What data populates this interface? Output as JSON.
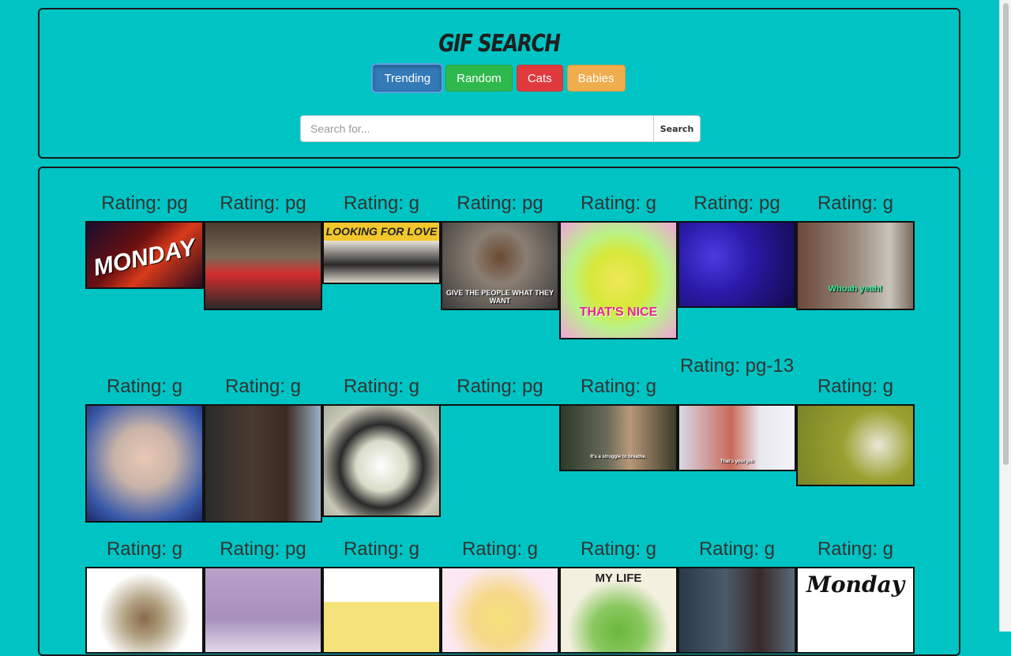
{
  "header": {
    "title": "GIF SEARCH",
    "buttons": [
      {
        "label": "Trending",
        "color": "#337ab7"
      },
      {
        "label": "Random",
        "color": "#2fb84c"
      },
      {
        "label": "Cats",
        "color": "#e0393e"
      },
      {
        "label": "Babies",
        "color": "#f0ad4e"
      }
    ],
    "search": {
      "placeholder": "Search for...",
      "button_label": "Search"
    }
  },
  "results": {
    "rows": [
      [
        {
          "rating": "Rating: pg",
          "caption": "MONDAY"
        },
        {
          "rating": "Rating: pg",
          "caption": ""
        },
        {
          "rating": "Rating: g",
          "caption": "LOOKING FOR LOVE"
        },
        {
          "rating": "Rating: pg",
          "caption": "GIVE THE PEOPLE WHAT THEY WANT"
        },
        {
          "rating": "Rating: g",
          "caption": "THAT'S NICE"
        },
        {
          "rating": "Rating: pg",
          "caption": ""
        },
        {
          "rating": "Rating: g",
          "caption": "Whoah yeah!"
        }
      ],
      [
        {
          "rating": "Rating: g",
          "caption": ""
        },
        {
          "rating": "Rating: g",
          "caption": ""
        },
        {
          "rating": "Rating: g",
          "caption": ""
        },
        {
          "rating": "Rating: pg",
          "caption": ""
        },
        {
          "rating": "Rating: g",
          "caption": "It's a struggle to breathe."
        },
        {
          "rating": "Rating: pg-13",
          "caption": "That's your job"
        },
        {
          "rating": "Rating: g",
          "caption": ""
        }
      ],
      [
        {
          "rating": "Rating: g",
          "caption": ""
        },
        {
          "rating": "Rating: pg",
          "caption": ""
        },
        {
          "rating": "Rating: g",
          "caption": ""
        },
        {
          "rating": "Rating: g",
          "caption": ""
        },
        {
          "rating": "Rating: g",
          "caption": "MY LIFE"
        },
        {
          "rating": "Rating: g",
          "caption": ""
        },
        {
          "rating": "Rating: g",
          "caption": "Monday"
        }
      ]
    ]
  }
}
